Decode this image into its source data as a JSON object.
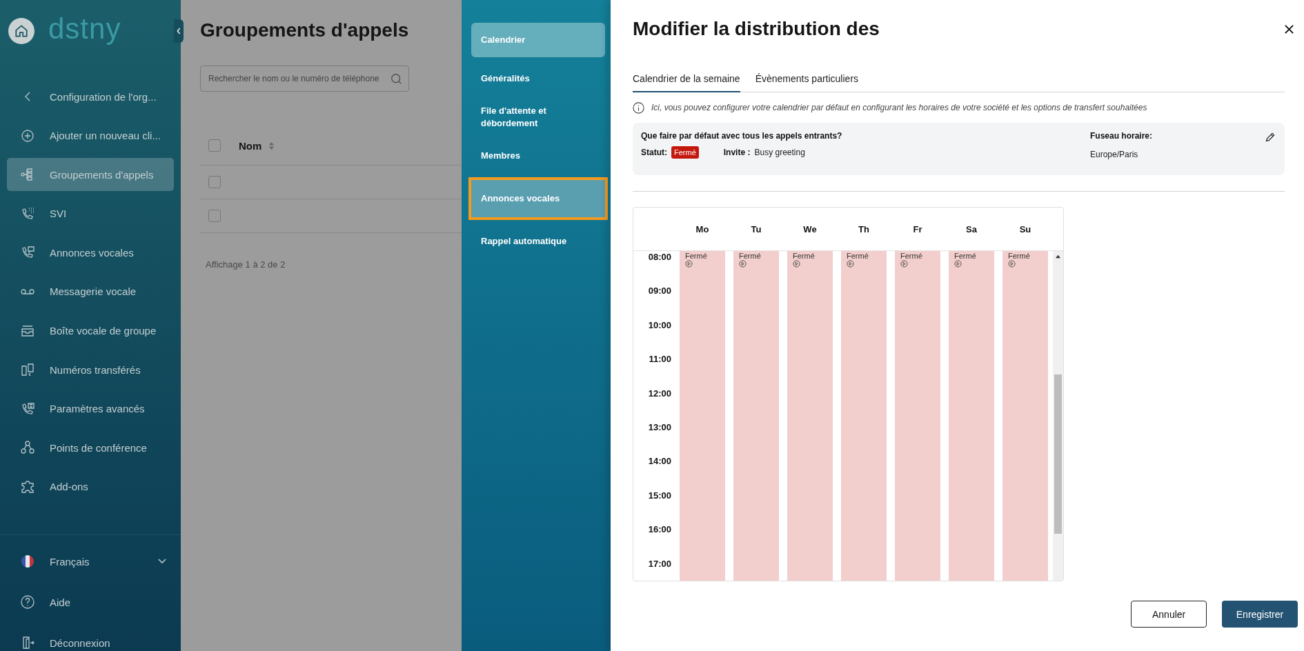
{
  "sidebar": {
    "logo": "dstny",
    "items": [
      {
        "label": "Configuration de l'org...",
        "selected": false
      },
      {
        "label": "Ajouter un nouveau cli...",
        "selected": false
      },
      {
        "label": "Groupements d'appels",
        "selected": true
      },
      {
        "label": "SVI",
        "selected": false
      },
      {
        "label": "Annonces vocales",
        "selected": false
      },
      {
        "label": "Messagerie vocale",
        "selected": false
      },
      {
        "label": "Boîte vocale de groupe",
        "selected": false
      },
      {
        "label": "Numéros transférés",
        "selected": false
      },
      {
        "label": "Paramètres avancés",
        "selected": false
      },
      {
        "label": "Points de conférence",
        "selected": false
      },
      {
        "label": "Add-ons",
        "selected": false
      }
    ],
    "language": "Français",
    "footer": [
      "Aide",
      "Déconnexion"
    ]
  },
  "page": {
    "title": "Groupements d'appels",
    "search": {
      "placeholder": "Rechercher le nom ou le numéro de téléphone"
    },
    "table": {
      "select_all": {
        "checked": false
      },
      "columns": [
        "Nom"
      ],
      "rows": [
        {
          "checked": false
        },
        {
          "checked": false
        }
      ]
    },
    "footer": "Affichage 1 à 2 de 2"
  },
  "settings_nav": {
    "items": [
      {
        "label": "Calendrier",
        "selected": true,
        "highlighted": false
      },
      {
        "label": "Généralités",
        "selected": false,
        "highlighted": false
      },
      {
        "label": "File d'attente et débordement",
        "selected": false,
        "highlighted": false
      },
      {
        "label": "Membres",
        "selected": false,
        "highlighted": false
      },
      {
        "label": "Annonces vocales",
        "selected": false,
        "highlighted": true
      },
      {
        "label": "Rappel automatique",
        "selected": false,
        "highlighted": false
      }
    ]
  },
  "panel": {
    "title": "Modifier la distribution des",
    "tabs": [
      {
        "label": "Calendrier de la semaine",
        "selected": true
      },
      {
        "label": "Évènements particuliers",
        "selected": false
      }
    ],
    "info": "Ici, vous pouvez configurer votre calendrier par défaut en configurant les horaires de votre société et les options de transfert souhaitées",
    "defaults": {
      "question": "Que faire par défaut avec tous les appels entrants?",
      "status_label": "Statut:",
      "status": "Fermé",
      "invite_label": "Invite :",
      "invite": "Busy greeting",
      "timezone_label": "Fuseau horaire:",
      "timezone": "Europe/Paris"
    },
    "calendar": {
      "days": [
        {
          "label": "Mo",
          "event": "Fermé"
        },
        {
          "label": "Tu",
          "event": "Fermé"
        },
        {
          "label": "We",
          "event": "Fermé"
        },
        {
          "label": "Th",
          "event": "Fermé"
        },
        {
          "label": "Fr",
          "event": "Fermé"
        },
        {
          "label": "Sa",
          "event": "Fermé"
        },
        {
          "label": "Su",
          "event": "Fermé"
        }
      ],
      "hours": [
        "08:00",
        "09:00",
        "10:00",
        "11:00",
        "12:00",
        "13:00",
        "14:00",
        "15:00",
        "16:00",
        "17:00"
      ]
    },
    "buttons": [
      {
        "label": "Annuler",
        "kind": "secondary"
      },
      {
        "label": "Enregistrer",
        "kind": "primary"
      }
    ]
  }
}
